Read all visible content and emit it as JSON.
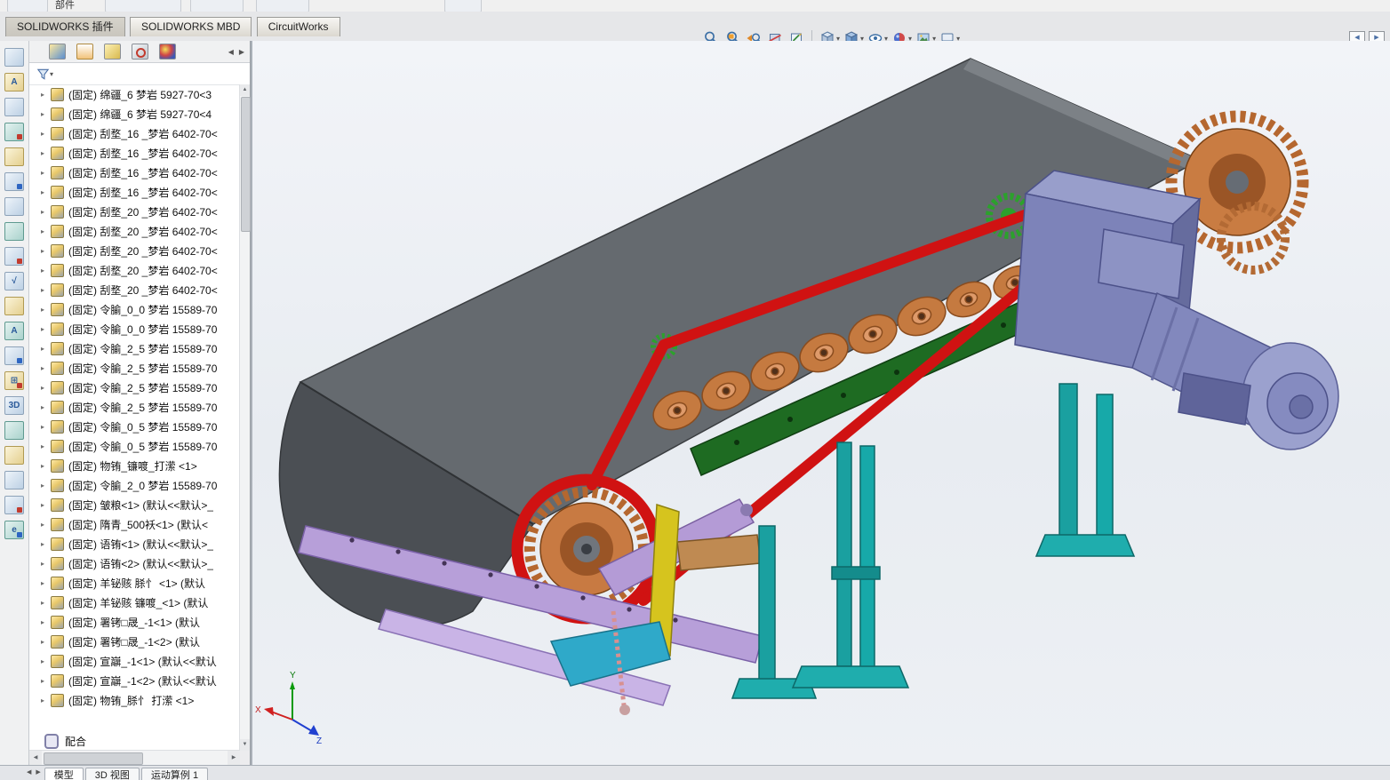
{
  "top_partial_row": {
    "labels": [
      "部件"
    ]
  },
  "ribbon_tabs": [
    {
      "label": "SOLIDWORKS 插件",
      "active": true
    },
    {
      "label": "SOLIDWORKS MBD",
      "active": false
    },
    {
      "label": "CircuitWorks",
      "active": false
    }
  ],
  "headsup_toolbar": {
    "icons": [
      "zoom-fit",
      "zoom-area",
      "previous-view",
      "section-view",
      "annotation-view",
      "view-orientation",
      "display-style",
      "hide-show-items",
      "edit-appearance",
      "apply-scene",
      "view-settings"
    ],
    "caret_glyph": "▾"
  },
  "corner_buttons": {
    "left_glyph": "◀",
    "right_glyph": "▶"
  },
  "left_toolbar": {
    "icons": [
      {
        "name": "assembly-features-icon",
        "glyph": ""
      },
      {
        "name": "spell-checker-icon",
        "glyph": "A"
      },
      {
        "name": "isolate-icon",
        "glyph": ""
      },
      {
        "name": "hidden-components-icon",
        "glyph": ""
      },
      {
        "name": "edit-component-icon",
        "glyph": ""
      },
      {
        "name": "mate-icon",
        "glyph": ""
      },
      {
        "name": "component-pattern-icon",
        "glyph": ""
      },
      {
        "name": "smart-fasteners-icon",
        "glyph": ""
      },
      {
        "name": "move-component-icon",
        "glyph": ""
      },
      {
        "name": "exploded-view-icon",
        "glyph": "√"
      },
      {
        "name": "sketch-icon",
        "glyph": ""
      },
      {
        "name": "note-icon",
        "glyph": "A"
      },
      {
        "name": "measure-icon",
        "glyph": ""
      },
      {
        "name": "table-icon",
        "glyph": "⊞"
      },
      {
        "name": "3d-drawing-view-icon",
        "glyph": "3D"
      },
      {
        "name": "section-view-icon",
        "glyph": ""
      },
      {
        "name": "camera-icon",
        "glyph": ""
      },
      {
        "name": "simulation-icon",
        "glyph": ""
      },
      {
        "name": "motion-study-icon",
        "glyph": ""
      },
      {
        "name": "edrawings-icon",
        "glyph": "e"
      }
    ]
  },
  "feature_tree": {
    "manager_tabs": [
      "featuremanager-design-tree",
      "propertymanager",
      "configurationmanager",
      "dimxpertmanager",
      "displaymanager"
    ],
    "tab_scroll": {
      "left": "◀",
      "right": "▶"
    },
    "expand_glyph": "▸",
    "scrollbar": {
      "up": "▲",
      "down": "▼",
      "left": "◀",
      "right": "▶"
    },
    "items": [
      "(固定) 绵疆_6 梦岩 5927-70<3",
      "(固定) 绵疆_6 梦岩 5927-70<4",
      "(固定) 刮堥_16 _梦岩 6402-70<",
      "(固定) 刮堥_16 _梦岩 6402-70<",
      "(固定) 刮堥_16 _梦岩 6402-70<",
      "(固定) 刮堥_16 _梦岩 6402-70<",
      "(固定) 刮堥_20 _梦岩 6402-70<",
      "(固定) 刮堥_20 _梦岩 6402-70<",
      "(固定) 刮堥_20 _梦岩 6402-70<",
      "(固定) 刮堥_20 _梦岩 6402-70<",
      "(固定) 刮堥_20 _梦岩 6402-70<",
      "(固定) 令腧_0_0 梦岩 15589-70",
      "(固定) 令腧_0_0 梦岩 15589-70",
      "(固定) 令腧_2_5 梦岩 15589-70",
      "(固定) 令腧_2_5 梦岩 15589-70",
      "(固定) 令腧_2_5 梦岩 15589-70",
      "(固定) 令腧_2_5 梦岩 15589-70",
      "(固定) 令腧_0_5 梦岩 15589-70",
      "(固定) 令腧_0_5 梦岩 15589-70",
      "(固定) 物铕_镰喥_打潆  <1>",
      "(固定) 令腧_2_0 梦岩 15589-70",
      "(固定) 皱粮<1> (默认<<默认>_",
      "(固定) 隋青_500袄<1> (默认<",
      "(固定) 语铕<1> (默认<<默认>_",
      "(固定) 语铕<2> (默认<<默认>_",
      "(固定) 羊铋赅 脎忄  <1> (默认",
      "(固定) 羊铋赅 镰喥_<1> (默认",
      "(固定) 署铐□晟_-1<1> (默认",
      "(固定) 署铐□晟_-1<2> (默认",
      "(固定) 宣巐_-1<1> (默认<<默认",
      "(固定) 宣巐_-1<2> (默认<<默认",
      "(固定) 物铕_脎忄 打潆  <1>"
    ],
    "mates_label": "配合"
  },
  "viewport": {
    "triad": {
      "x": "X",
      "y": "Y",
      "z": "Z"
    },
    "colors": {
      "belt": "#656a6f",
      "belt_drum": "#4b4f54",
      "rollers": "#c57a40",
      "chain": "#d01212",
      "frame_green": "#1e6b22",
      "sprocket_green": "#2ca12c",
      "gearbox": "#7d83b9",
      "legs_teal": "#1aa0a0",
      "panel_purple": "#b79fd9",
      "accent_yellow": "#d6c41e"
    }
  },
  "bottom_bar": {
    "nav_left": "◀",
    "nav_right": "▶",
    "tabs": [
      "模型",
      "3D 视图",
      "运动算例 1"
    ]
  }
}
